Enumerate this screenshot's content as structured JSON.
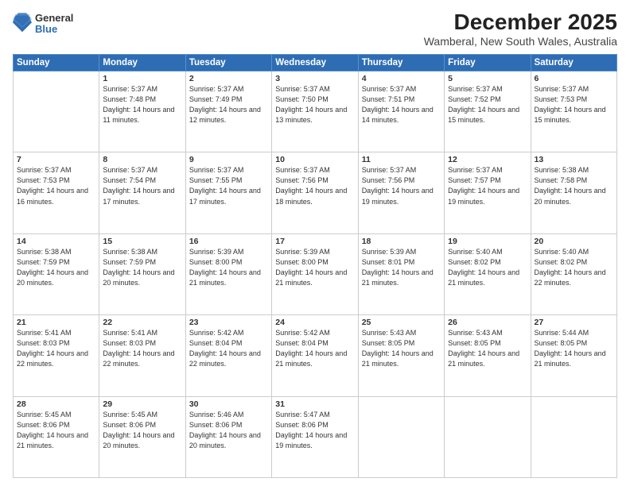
{
  "header": {
    "logo_general": "General",
    "logo_blue": "Blue",
    "title": "December 2025",
    "subtitle": "Wamberal, New South Wales, Australia"
  },
  "days_of_week": [
    "Sunday",
    "Monday",
    "Tuesday",
    "Wednesday",
    "Thursday",
    "Friday",
    "Saturday"
  ],
  "weeks": [
    [
      {
        "day": "",
        "sunrise": "",
        "sunset": "",
        "daylight": ""
      },
      {
        "day": "1",
        "sunrise": "Sunrise: 5:37 AM",
        "sunset": "Sunset: 7:48 PM",
        "daylight": "Daylight: 14 hours and 11 minutes."
      },
      {
        "day": "2",
        "sunrise": "Sunrise: 5:37 AM",
        "sunset": "Sunset: 7:49 PM",
        "daylight": "Daylight: 14 hours and 12 minutes."
      },
      {
        "day": "3",
        "sunrise": "Sunrise: 5:37 AM",
        "sunset": "Sunset: 7:50 PM",
        "daylight": "Daylight: 14 hours and 13 minutes."
      },
      {
        "day": "4",
        "sunrise": "Sunrise: 5:37 AM",
        "sunset": "Sunset: 7:51 PM",
        "daylight": "Daylight: 14 hours and 14 minutes."
      },
      {
        "day": "5",
        "sunrise": "Sunrise: 5:37 AM",
        "sunset": "Sunset: 7:52 PM",
        "daylight": "Daylight: 14 hours and 15 minutes."
      },
      {
        "day": "6",
        "sunrise": "Sunrise: 5:37 AM",
        "sunset": "Sunset: 7:53 PM",
        "daylight": "Daylight: 14 hours and 15 minutes."
      }
    ],
    [
      {
        "day": "7",
        "sunrise": "Sunrise: 5:37 AM",
        "sunset": "Sunset: 7:53 PM",
        "daylight": "Daylight: 14 hours and 16 minutes."
      },
      {
        "day": "8",
        "sunrise": "Sunrise: 5:37 AM",
        "sunset": "Sunset: 7:54 PM",
        "daylight": "Daylight: 14 hours and 17 minutes."
      },
      {
        "day": "9",
        "sunrise": "Sunrise: 5:37 AM",
        "sunset": "Sunset: 7:55 PM",
        "daylight": "Daylight: 14 hours and 17 minutes."
      },
      {
        "day": "10",
        "sunrise": "Sunrise: 5:37 AM",
        "sunset": "Sunset: 7:56 PM",
        "daylight": "Daylight: 14 hours and 18 minutes."
      },
      {
        "day": "11",
        "sunrise": "Sunrise: 5:37 AM",
        "sunset": "Sunset: 7:56 PM",
        "daylight": "Daylight: 14 hours and 19 minutes."
      },
      {
        "day": "12",
        "sunrise": "Sunrise: 5:37 AM",
        "sunset": "Sunset: 7:57 PM",
        "daylight": "Daylight: 14 hours and 19 minutes."
      },
      {
        "day": "13",
        "sunrise": "Sunrise: 5:38 AM",
        "sunset": "Sunset: 7:58 PM",
        "daylight": "Daylight: 14 hours and 20 minutes."
      }
    ],
    [
      {
        "day": "14",
        "sunrise": "Sunrise: 5:38 AM",
        "sunset": "Sunset: 7:59 PM",
        "daylight": "Daylight: 14 hours and 20 minutes."
      },
      {
        "day": "15",
        "sunrise": "Sunrise: 5:38 AM",
        "sunset": "Sunset: 7:59 PM",
        "daylight": "Daylight: 14 hours and 20 minutes."
      },
      {
        "day": "16",
        "sunrise": "Sunrise: 5:39 AM",
        "sunset": "Sunset: 8:00 PM",
        "daylight": "Daylight: 14 hours and 21 minutes."
      },
      {
        "day": "17",
        "sunrise": "Sunrise: 5:39 AM",
        "sunset": "Sunset: 8:00 PM",
        "daylight": "Daylight: 14 hours and 21 minutes."
      },
      {
        "day": "18",
        "sunrise": "Sunrise: 5:39 AM",
        "sunset": "Sunset: 8:01 PM",
        "daylight": "Daylight: 14 hours and 21 minutes."
      },
      {
        "day": "19",
        "sunrise": "Sunrise: 5:40 AM",
        "sunset": "Sunset: 8:02 PM",
        "daylight": "Daylight: 14 hours and 21 minutes."
      },
      {
        "day": "20",
        "sunrise": "Sunrise: 5:40 AM",
        "sunset": "Sunset: 8:02 PM",
        "daylight": "Daylight: 14 hours and 22 minutes."
      }
    ],
    [
      {
        "day": "21",
        "sunrise": "Sunrise: 5:41 AM",
        "sunset": "Sunset: 8:03 PM",
        "daylight": "Daylight: 14 hours and 22 minutes."
      },
      {
        "day": "22",
        "sunrise": "Sunrise: 5:41 AM",
        "sunset": "Sunset: 8:03 PM",
        "daylight": "Daylight: 14 hours and 22 minutes."
      },
      {
        "day": "23",
        "sunrise": "Sunrise: 5:42 AM",
        "sunset": "Sunset: 8:04 PM",
        "daylight": "Daylight: 14 hours and 22 minutes."
      },
      {
        "day": "24",
        "sunrise": "Sunrise: 5:42 AM",
        "sunset": "Sunset: 8:04 PM",
        "daylight": "Daylight: 14 hours and 21 minutes."
      },
      {
        "day": "25",
        "sunrise": "Sunrise: 5:43 AM",
        "sunset": "Sunset: 8:05 PM",
        "daylight": "Daylight: 14 hours and 21 minutes."
      },
      {
        "day": "26",
        "sunrise": "Sunrise: 5:43 AM",
        "sunset": "Sunset: 8:05 PM",
        "daylight": "Daylight: 14 hours and 21 minutes."
      },
      {
        "day": "27",
        "sunrise": "Sunrise: 5:44 AM",
        "sunset": "Sunset: 8:05 PM",
        "daylight": "Daylight: 14 hours and 21 minutes."
      }
    ],
    [
      {
        "day": "28",
        "sunrise": "Sunrise: 5:45 AM",
        "sunset": "Sunset: 8:06 PM",
        "daylight": "Daylight: 14 hours and 21 minutes."
      },
      {
        "day": "29",
        "sunrise": "Sunrise: 5:45 AM",
        "sunset": "Sunset: 8:06 PM",
        "daylight": "Daylight: 14 hours and 20 minutes."
      },
      {
        "day": "30",
        "sunrise": "Sunrise: 5:46 AM",
        "sunset": "Sunset: 8:06 PM",
        "daylight": "Daylight: 14 hours and 20 minutes."
      },
      {
        "day": "31",
        "sunrise": "Sunrise: 5:47 AM",
        "sunset": "Sunset: 8:06 PM",
        "daylight": "Daylight: 14 hours and 19 minutes."
      },
      {
        "day": "",
        "sunrise": "",
        "sunset": "",
        "daylight": ""
      },
      {
        "day": "",
        "sunrise": "",
        "sunset": "",
        "daylight": ""
      },
      {
        "day": "",
        "sunrise": "",
        "sunset": "",
        "daylight": ""
      }
    ]
  ]
}
